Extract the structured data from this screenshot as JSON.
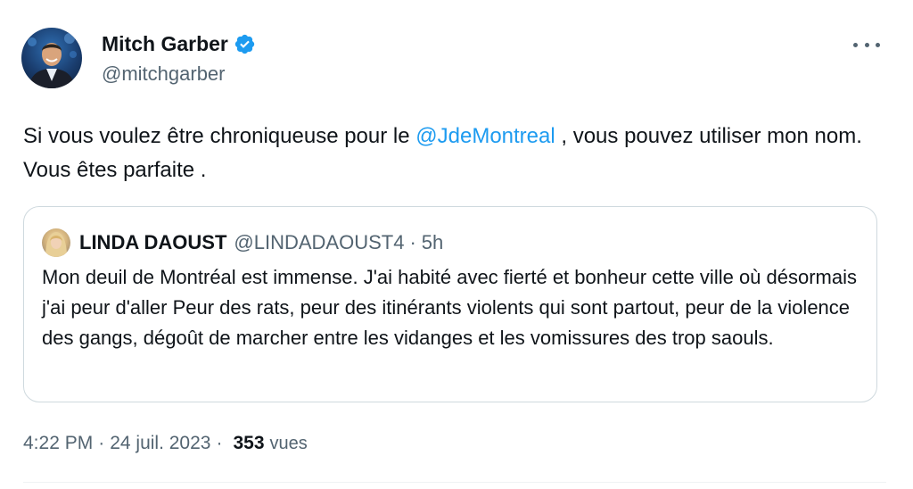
{
  "author": {
    "display_name": "Mitch Garber",
    "handle": "@mitchgarber",
    "verified_icon": "verified-badge-icon"
  },
  "colors": {
    "link": "#1d9bf0",
    "secondary_text": "#536471",
    "border": "#cfd9de"
  },
  "tweet": {
    "text_before": "Si vous voulez être chroniqueuse pour le ",
    "mention": "@JdeMontreal",
    "text_after": " , vous pouvez utiliser mon nom. Vous êtes parfaite ."
  },
  "quote": {
    "display_name": "LINDA DAOUST",
    "handle": "@LINDADAOUST4",
    "separator": "·",
    "time": "5h",
    "text": "Mon deuil de Montréal est immense. J'ai habité avec fierté et bonheur cette ville où désormais j'ai peur d'aller  Peur des rats, peur des itinérants violents qui sont partout, peur de la violence des gangs, dégoût de marcher entre les vidanges et les vomissures des trop saouls."
  },
  "meta": {
    "time": "4:22 PM",
    "separator": "·",
    "date": "24 juil. 2023",
    "views_count": "353",
    "views_label": "vues"
  }
}
